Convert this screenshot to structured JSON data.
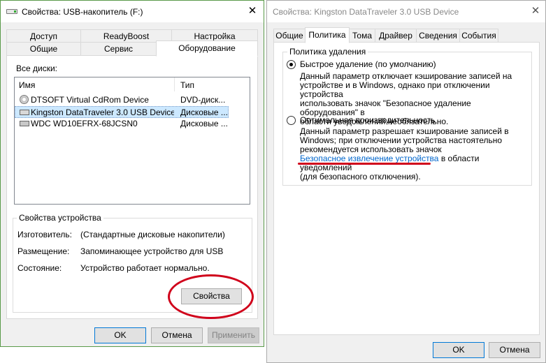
{
  "left_window": {
    "title": "Свойства: USB-накопитель (F:)",
    "close_glyph": "✕",
    "tabs_row1": [
      "Доступ",
      "ReadyBoost",
      "Настройка"
    ],
    "tabs_row2": [
      "Общие",
      "Сервис",
      "Оборудование"
    ],
    "all_disks_label": "Все диски:",
    "columns": {
      "name": "Имя",
      "type": "Тип"
    },
    "disks": [
      {
        "name": "DTSOFT Virtual CdRom Device",
        "type": "DVD-диск...",
        "icon": "cdrom-icon"
      },
      {
        "name": "Kingston DataTraveler 3.0 USB Device",
        "type": "Дисковые ...",
        "icon": "usb-drive-icon",
        "selected": true
      },
      {
        "name": "WDC WD10EFRX-68JCSN0",
        "type": "Дисковые ...",
        "icon": "hard-drive-icon"
      }
    ],
    "device_props": {
      "title": "Свойства устройства",
      "manufacturer_label": "Изготовитель:",
      "manufacturer_value": "(Стандартные дисковые накопители)",
      "location_label": "Размещение:",
      "location_value": "Запоминающее устройство для USB",
      "status_label": "Состояние:",
      "status_value": "Устройство работает нормально.",
      "properties_button": "Свойства"
    },
    "buttons": {
      "ok": "OK",
      "cancel": "Отмена",
      "apply": "Применить"
    }
  },
  "right_window": {
    "title": "Свойства: Kingston DataTraveler 3.0 USB Device",
    "close_glyph": "✕",
    "tabs": [
      "Общие",
      "Политика",
      "Тома",
      "Драйвер",
      "Сведения",
      "События"
    ],
    "selected_tab": "Политика",
    "policy": {
      "group_title": "Политика удаления",
      "quick_label": "Быстрое удаление (по умолчанию)",
      "quick_desc": [
        "Данный параметр отключает кэширование записей на",
        "устройстве и в Windows, однако при отключении устройства",
        "использовать значок \"Безопасное удаление оборудования\" в",
        "области уведомлений необязательно."
      ],
      "perf_label": "Оптимальная производительность",
      "perf_desc": [
        "Данный параметр разрешает кэширование записей в",
        "Windows; при отключении устройства настоятельно",
        "рекомендуется использовать значок"
      ],
      "perf_link": "Безопасное извлечение устройства",
      "perf_after_link": " в области уведомлений",
      "perf_last": "(для безопасного отключения)."
    },
    "buttons": {
      "ok": "OK",
      "cancel": "Отмена"
    }
  },
  "annotation_color": "#d0021b"
}
